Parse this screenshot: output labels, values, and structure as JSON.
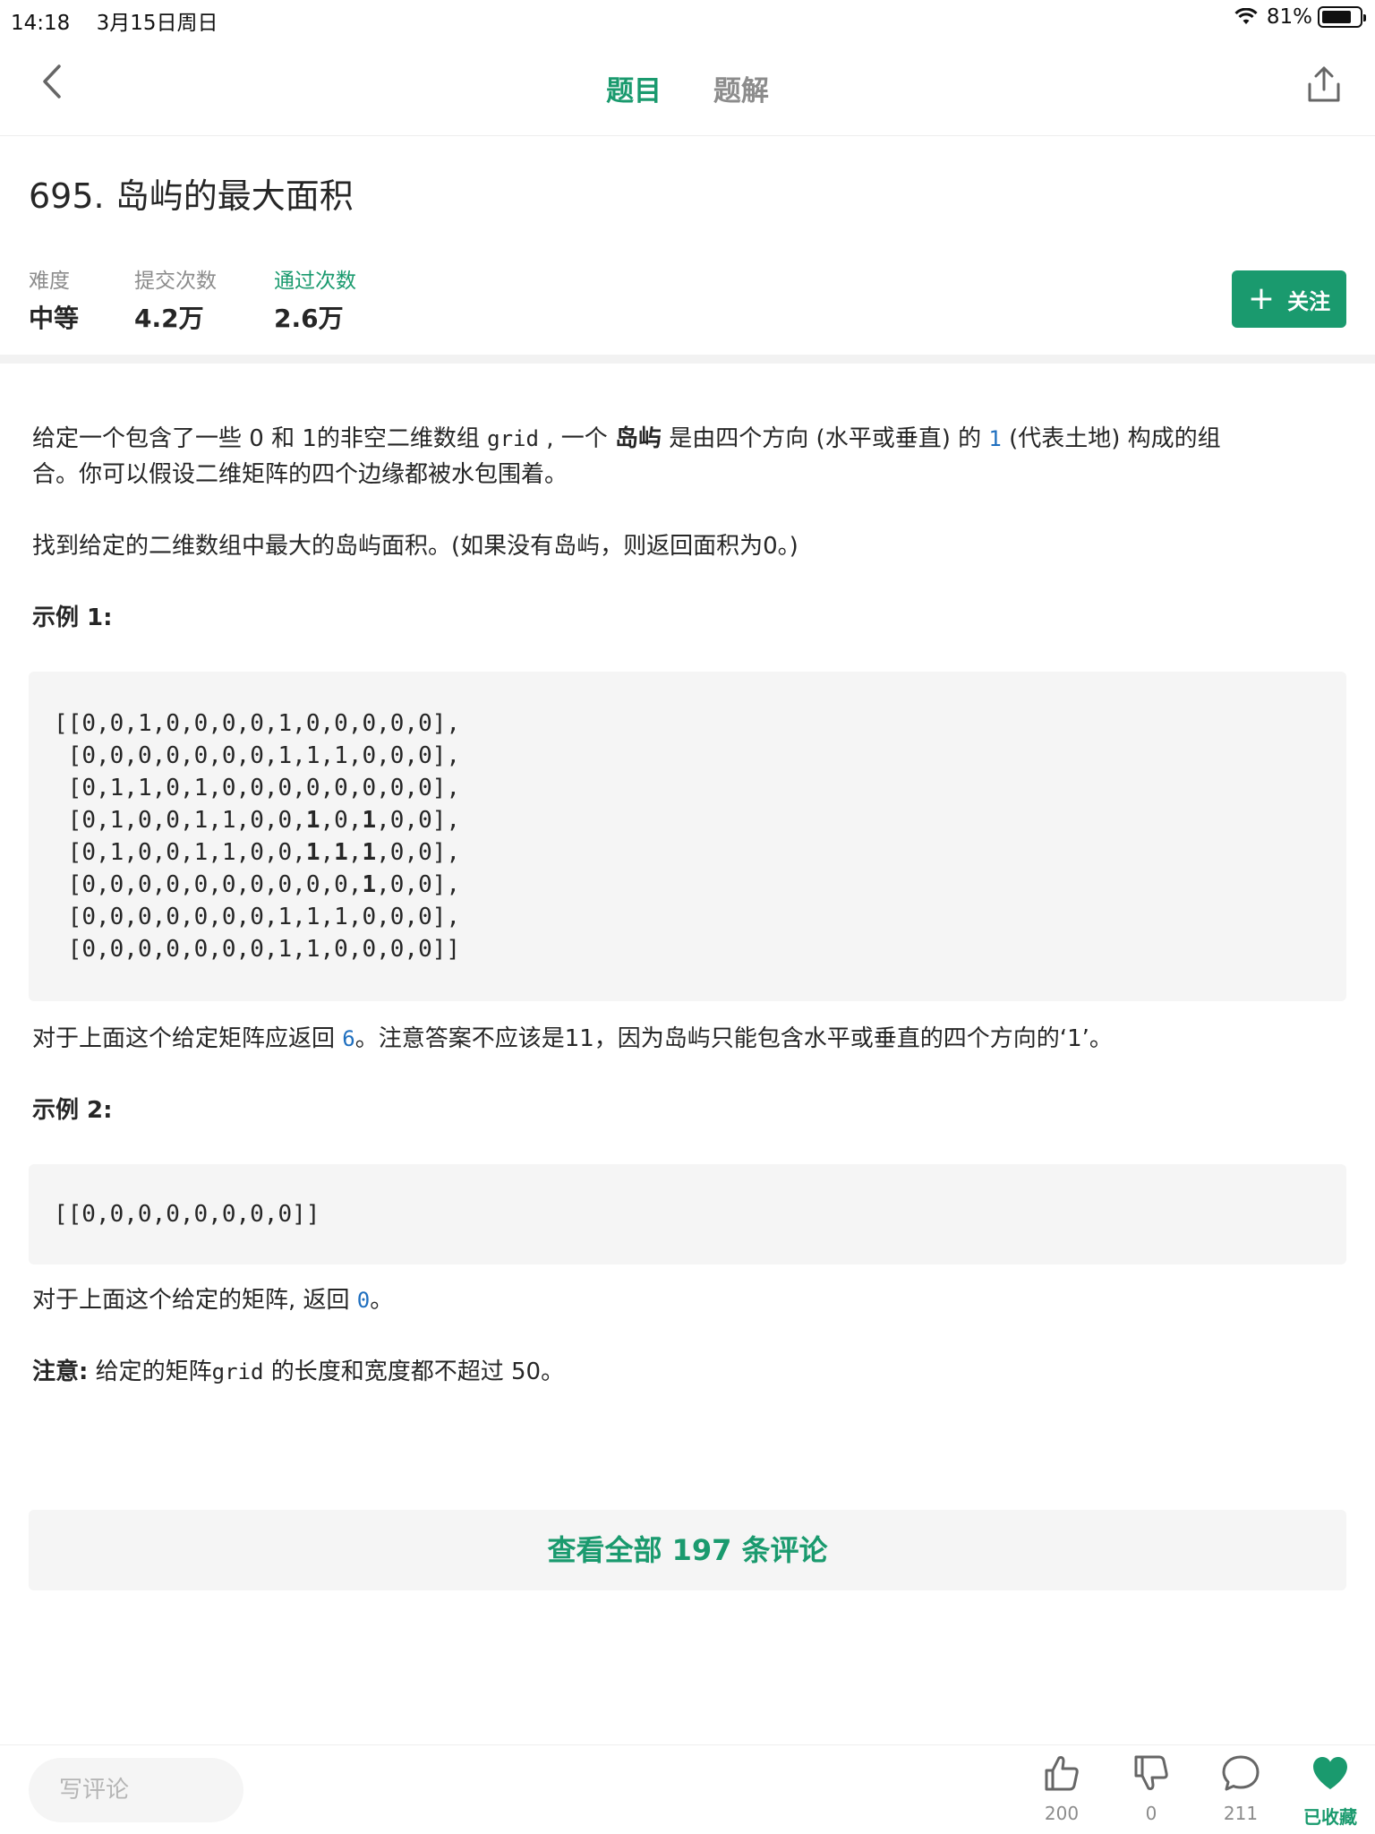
{
  "status": {
    "time": "14:18",
    "date": "3月15日周日",
    "battery": "81%",
    "battery_level": 0.81
  },
  "nav": {
    "tab_problem": "题目",
    "tab_solution": "题解"
  },
  "problem": {
    "title": "695. 岛屿的最大面积",
    "difficulty_label": "难度",
    "difficulty_value": "中等",
    "submissions_label": "提交次数",
    "submissions_value": "4.2万",
    "accepted_label": "通过次数",
    "accepted_value": "2.6万",
    "follow_label": "关注"
  },
  "content": {
    "p1_a": "给定一个包含了一些 0 和 1的非空二维数组 ",
    "p1_code": "grid",
    "p1_b": " , 一个 ",
    "p1_bold": "岛屿",
    "p1_c": " 是由四个方向 (水平或垂直) 的 ",
    "p1_one": "1",
    "p1_d": " (代表土地) 构成的组",
    "p1_e": "合。你可以假设二维矩阵的四个边缘都被水包围着。",
    "p2": "找到给定的二维数组中最大的岛屿面积。(如果没有岛屿，则返回面积为0。)",
    "example1_title": "示例 1:",
    "example1_rows": [
      "[[0,0,1,0,0,0,0,1,0,0,0,0,0],",
      " [0,0,0,0,0,0,0,1,1,1,0,0,0],",
      " [0,1,1,0,1,0,0,0,0,0,0,0,0],",
      " [0,1,0,0,1,1,0,0,1,0,1,0,0],",
      " [0,1,0,0,1,1,0,0,1,1,1,0,0],",
      " [0,0,0,0,0,0,0,0,0,0,1,0,0],",
      " [0,0,0,0,0,0,0,1,1,1,0,0,0],",
      " [0,0,0,0,0,0,0,1,1,0,0,0,0]]"
    ],
    "example1_bold": [
      [
        3,
        8
      ],
      [
        3,
        10
      ],
      [
        4,
        8
      ],
      [
        4,
        9
      ],
      [
        4,
        10
      ],
      [
        5,
        10
      ]
    ],
    "p3_a": "对于上面这个给定矩阵应返回 ",
    "p3_code": "6",
    "p3_b": "。注意答案不应该是11，因为岛屿只能包含水平或垂直的四个方向的‘1’。",
    "example2_title": "示例 2:",
    "example2_code": "[[0,0,0,0,0,0,0,0]]",
    "p4_a": "对于上面这个给定的矩阵, 返回 ",
    "p4_code": "0",
    "p4_b": "。",
    "note_bold": "注意:",
    "note_a": " 给定的矩阵",
    "note_code": "grid",
    "note_b": " 的长度和宽度都不超过 50。"
  },
  "comments_button": "查看全部 197 条评论",
  "bottom": {
    "write_placeholder": "写评论",
    "likes": "200",
    "dislikes": "0",
    "comments": "211",
    "favorite": "已收藏"
  },
  "colors": {
    "accent": "#1a9a6e",
    "code_blue": "#1f6fbf"
  }
}
